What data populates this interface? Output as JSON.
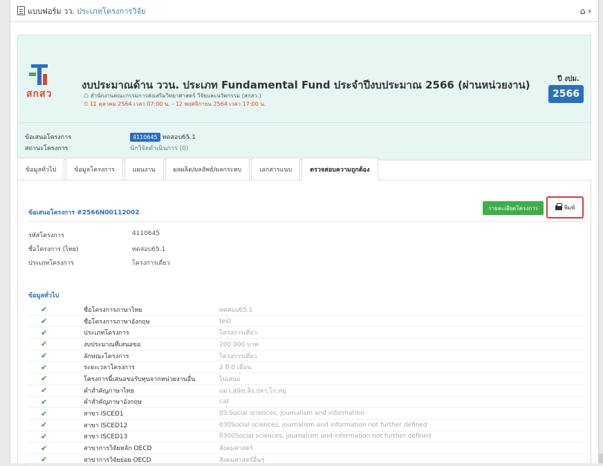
{
  "topbar": {
    "title": "แบบฟอร์ม วว.",
    "link": "ประเภทโครงการวิจัย",
    "home_glyph": "⌂ ›"
  },
  "header": {
    "title": "งบประมาณด้าน ววน. ประเภท Fundamental Fund ประจำปีงบประมาณ 2566 (ผ่านหน่วยงาน)",
    "subtitle": "☖ สำนักงานคณะกรรมการส่งเสริมวิทยาศาสตร์ วิจัยและนวัตกรรม (สกสว.)",
    "date": "⏲ 11 ตุลาคม 2564 เวลา 07:00 น. - 12 พฤศจิกายน 2564 เวลา 17:00 น.",
    "logo_text": "สกสว",
    "fy_label": "ปี งปม.",
    "fy_value": "2566"
  },
  "meta": {
    "proposal_label": "ข้อเสนอโครงการ",
    "proposal_id": "4110645",
    "proposal_name": "ทดสอบ65.1",
    "status_label": "สถานะโครงการ",
    "status_value": "นักวิจัยดำเนินการ (0)"
  },
  "tabs": [
    "ข้อมูลทั่วไป",
    "ข้อมูลโครงการ",
    "แผนงาน",
    "ผลผลิต/ผลลัพธ์/ผลกระทบ",
    "เอกสารแนบ",
    "ตรวจสอบความถูกต้อง"
  ],
  "panel": {
    "title": "ข้อเสนอโครงการ #2566N00112002",
    "green_button": "รายละเอียดโครงการ",
    "print_button": "พิมพ์"
  },
  "details": [
    {
      "k": "รหัสโครงการ",
      "v": "4110645"
    },
    {
      "k": "ชื่อโครงการ (ไทย)",
      "v": "ทดสอบ65.1"
    },
    {
      "k": "ประเภทโครงการ",
      "v": "โครงการเดี่ยว"
    }
  ],
  "section_title": "ข้อมูลทั่วไป",
  "checks": [
    {
      "label": "ชื่อโครงการภาษาไทย",
      "value": "ทดสอบ65.1"
    },
    {
      "label": "ชื่อโครงการภาษาอังกฤษ",
      "value": "test"
    },
    {
      "label": "ประเภทโครงการ",
      "value": "โครงการเดี่ยว"
    },
    {
      "label": "งบประมาณที่เสนอขอ",
      "value": "200,000 บาท"
    },
    {
      "label": "ลักษณะโครงการ",
      "value": "โครงการเดี่ยว"
    },
    {
      "label": "ระยะเวลาโครงการ",
      "value": "2 ปี 0 เดือน"
    },
    {
      "label": "โครงการนี้เสนอขอรับทุนจากหน่วยงานอื่น",
      "value": "ไม่เสนอ"
    },
    {
      "label": "คำสำคัญภาษาไทย",
      "value": "แมว,สุนัข,ลิง,ปลา,ไก่,หมู"
    },
    {
      "label": "คำสำคัญภาษาอังกฤษ",
      "value": "cat"
    },
    {
      "label": "สาขา ISCED1",
      "value": "03 Social sciences, journalism and information"
    },
    {
      "label": "สาขา ISCED12",
      "value": "030Social sciences, journalism and information not further defined"
    },
    {
      "label": "สาขา ISCED13",
      "value": "0300Social sciences, journalism and information not further defined"
    },
    {
      "label": "สาขาการวิจัยหลัก OECD",
      "value": "สังคมศาสตร์"
    },
    {
      "label": "สาขาการวิจัยย่อย OECD",
      "value": "สังคมศาสตร์อื่นๆ"
    }
  ],
  "check_glyph": "✔"
}
